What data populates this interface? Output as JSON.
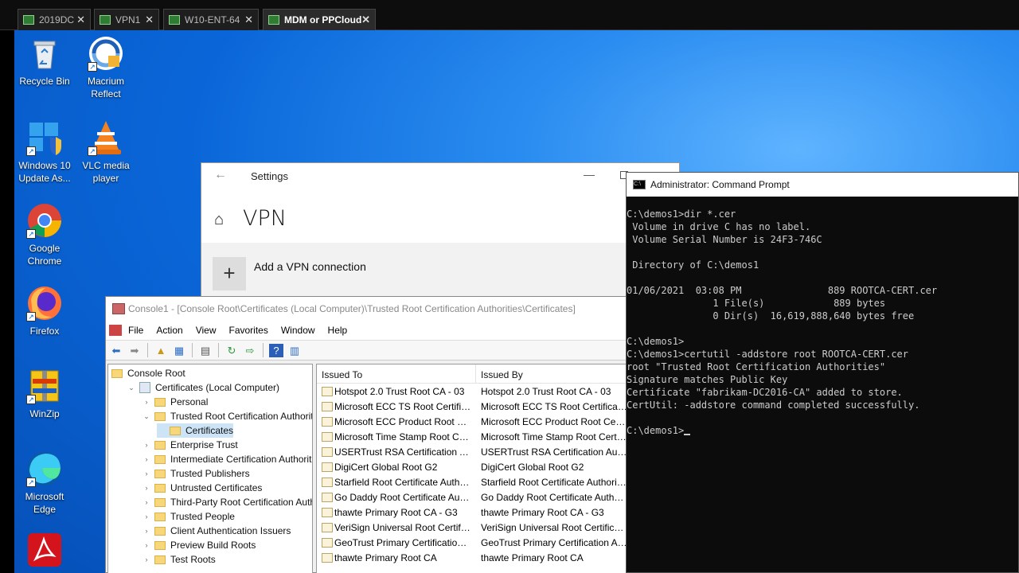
{
  "vm_tabs": [
    {
      "label": "2019DC",
      "active": false
    },
    {
      "label": "VPN1",
      "active": false
    },
    {
      "label": "W10-ENT-64",
      "active": false
    },
    {
      "label": "MDM or PPCloud",
      "active": true
    }
  ],
  "desktop_icons": [
    {
      "label": "Recycle Bin",
      "icon": "recycle-bin-icon"
    },
    {
      "label": "Macrium Reflect",
      "icon": "macrium-reflect-icon"
    },
    {
      "label": "Windows 10 Update As...",
      "icon": "windows-update-icon"
    },
    {
      "label": "VLC media player",
      "icon": "vlc-icon"
    },
    {
      "label": "Google Chrome",
      "icon": "chrome-icon"
    },
    {
      "label": "Firefox",
      "icon": "firefox-icon"
    },
    {
      "label": "WinZip",
      "icon": "winzip-icon"
    },
    {
      "label": "Microsoft Edge",
      "icon": "edge-icon"
    },
    {
      "label": "",
      "icon": "acrobat-icon"
    }
  ],
  "settings": {
    "title": "Settings",
    "heading": "VPN",
    "add_label": "Add a VPN connection"
  },
  "mmc": {
    "title": "Console1 - [Console Root\\Certificates (Local Computer)\\Trusted Root Certification Authorities\\Certificates]",
    "menu": [
      "File",
      "Action",
      "View",
      "Favorites",
      "Window",
      "Help"
    ],
    "tree": [
      {
        "label": "Console Root",
        "level": 0,
        "exp": "",
        "icon": "folder"
      },
      {
        "label": "Certificates (Local Computer)",
        "level": 1,
        "exp": "v",
        "icon": "certs"
      },
      {
        "label": "Personal",
        "level": 2,
        "exp": ">",
        "icon": "folder"
      },
      {
        "label": "Trusted Root Certification Authorities",
        "level": 2,
        "exp": "v",
        "icon": "folder"
      },
      {
        "label": "Certificates",
        "level": 3,
        "exp": "",
        "icon": "folder",
        "selected": true
      },
      {
        "label": "Enterprise Trust",
        "level": 2,
        "exp": ">",
        "icon": "folder"
      },
      {
        "label": "Intermediate Certification Authorities",
        "level": 2,
        "exp": ">",
        "icon": "folder"
      },
      {
        "label": "Trusted Publishers",
        "level": 2,
        "exp": ">",
        "icon": "folder"
      },
      {
        "label": "Untrusted Certificates",
        "level": 2,
        "exp": ">",
        "icon": "folder"
      },
      {
        "label": "Third-Party Root Certification Authori",
        "level": 2,
        "exp": ">",
        "icon": "folder"
      },
      {
        "label": "Trusted People",
        "level": 2,
        "exp": ">",
        "icon": "folder"
      },
      {
        "label": "Client Authentication Issuers",
        "level": 2,
        "exp": ">",
        "icon": "folder"
      },
      {
        "label": "Preview Build Roots",
        "level": 2,
        "exp": ">",
        "icon": "folder"
      },
      {
        "label": "Test Roots",
        "level": 2,
        "exp": ">",
        "icon": "folder"
      }
    ],
    "columns": [
      "Issued To",
      "Issued By"
    ],
    "rows": [
      [
        "Hotspot 2.0 Trust Root CA - 03",
        "Hotspot 2.0 Trust Root CA - 03"
      ],
      [
        "Microsoft ECC TS Root Certificat...",
        "Microsoft ECC TS Root Certificate ..."
      ],
      [
        "Microsoft ECC Product Root Cert...",
        "Microsoft ECC Product Root Certifi..."
      ],
      [
        "Microsoft Time Stamp Root Cert...",
        "Microsoft Time Stamp Root Certifi..."
      ],
      [
        "USERTrust RSA Certification Auth...",
        "USERTrust RSA Certification Author..."
      ],
      [
        "DigiCert Global Root G2",
        "DigiCert Global Root G2"
      ],
      [
        "Starfield Root Certificate Authori...",
        "Starfield Root Certificate Authority..."
      ],
      [
        "Go Daddy Root Certificate Auth...",
        "Go Daddy Root Certificate Authorit..."
      ],
      [
        "thawte Primary Root CA - G3",
        "thawte Primary Root CA - G3"
      ],
      [
        "VeriSign Universal Root Certifica...",
        "VeriSign Universal Root Certificatio..."
      ],
      [
        "GeoTrust Primary Certification A...",
        "GeoTrust Primary Certification Aut..."
      ],
      [
        "thawte Primary Root CA",
        "thawte Primary Root CA"
      ]
    ]
  },
  "cmd": {
    "title": "Administrator: Command Prompt",
    "lines": [
      "C:\\demos1>dir *.cer",
      " Volume in drive C has no label.",
      " Volume Serial Number is 24F3-746C",
      "",
      " Directory of C:\\demos1",
      "",
      "01/06/2021  03:08 PM               889 ROOTCA-CERT.cer",
      "               1 File(s)            889 bytes",
      "               0 Dir(s)  16,619,888,640 bytes free",
      "",
      "C:\\demos1>",
      "C:\\demos1>certutil -addstore root ROOTCA-CERT.cer",
      "root \"Trusted Root Certification Authorities\"",
      "Signature matches Public Key",
      "Certificate \"fabrikam-DC2016-CA\" added to store.",
      "CertUtil: -addstore command completed successfully.",
      "",
      "C:\\demos1>"
    ]
  }
}
